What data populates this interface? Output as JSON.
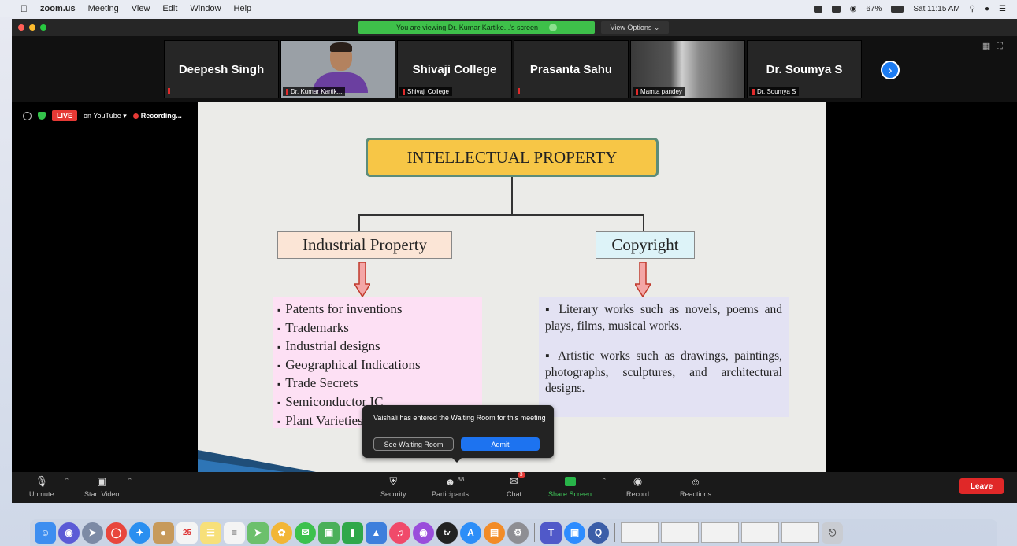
{
  "menubar": {
    "apple": "",
    "app": "zoom.us",
    "items": [
      "Meeting",
      "View",
      "Edit",
      "Window",
      "Help"
    ],
    "battery": "67%",
    "clock": "Sat 11:15 AM"
  },
  "window": {
    "viewing_text": "You are viewing Dr. Kumar Kartike...'s screen",
    "view_options": "View Options ⌄"
  },
  "gallery": {
    "tiles": [
      {
        "name": "Deepesh Singh",
        "sub": ""
      },
      {
        "name": "",
        "sub": "Dr. Kumar Kartik..."
      },
      {
        "name": "Shivaji College",
        "sub": "Shivaji College"
      },
      {
        "name": "Prasanta Sahu",
        "sub": ""
      },
      {
        "name": "",
        "sub": "Mamta pandey"
      },
      {
        "name": "Dr. Soumya S",
        "sub": "Dr. Soumya S"
      }
    ],
    "next_icon": "›"
  },
  "livebar": {
    "live": "LIVE",
    "youtube": "on YouTube ▾",
    "recording": "Recording..."
  },
  "slide": {
    "title": "INTELLECTUAL PROPERTY",
    "left_heading": "Industrial Property",
    "right_heading": "Copyright",
    "left_items": [
      "Patents for inventions",
      "Trademarks",
      "Industrial designs",
      "Geographical Indications",
      "Trade Secrets",
      "Semiconductor IC",
      "Plant Varieties"
    ],
    "right_items": [
      "▪ Literary works such as novels, poems and plays, films, musical works.",
      "▪ Artistic works such as drawings, paintings, photographs, sculptures, and architectural designs."
    ]
  },
  "toast": {
    "message": "Vaishali has entered the Waiting Room for this meeting",
    "see_button": "See Waiting Room",
    "admit_button": "Admit"
  },
  "controls": {
    "unmute": "Unmute",
    "start_video": "Start Video",
    "security": "Security",
    "participants": "Participants",
    "participants_count": "88",
    "chat": "Chat",
    "chat_badge": "3",
    "share_screen": "Share Screen",
    "record": "Record",
    "reactions": "Reactions",
    "leave": "Leave"
  },
  "colors": {
    "title_box": "#f7c646",
    "industrial_box": "#fbe5d6",
    "copyright_box": "#ddf3f8",
    "left_list_bg": "#fde0f4",
    "right_list_bg": "#e3e2f3",
    "leave": "#e02828",
    "admit": "#1d73f0",
    "share_green": "#28b449"
  },
  "dock": {
    "icons": [
      "finder-icon",
      "siri-icon",
      "launchpad-icon",
      "chrome-icon",
      "safari-icon",
      "contacts-icon",
      "calendar-icon",
      "notes-icon",
      "reminders-icon",
      "maps-icon",
      "photos-icon",
      "messages-icon",
      "facetime-icon",
      "numbers-icon",
      "keynote-icon",
      "music-icon",
      "podcasts-icon",
      "tv-icon",
      "app-store-icon",
      "books-icon",
      "system-preferences-icon",
      "teams-icon",
      "zoom-icon",
      "quicktime-icon"
    ]
  }
}
